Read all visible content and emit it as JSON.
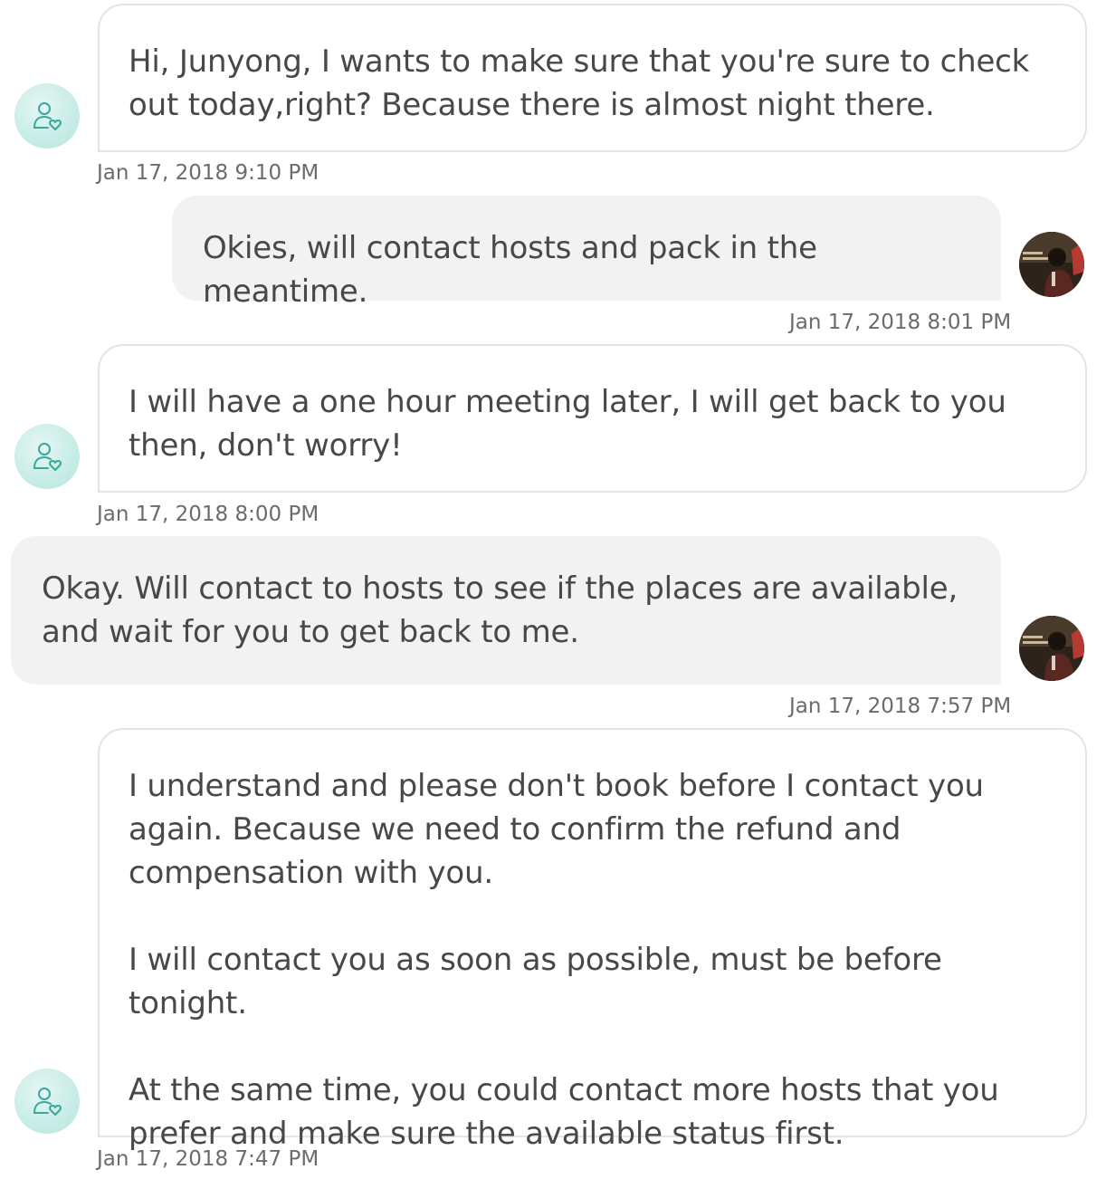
{
  "messages": [
    {
      "sender": "host",
      "text": "Hi, Junyong, I wants to make sure that you're sure to check out today,right? Because there is almost night there.",
      "timestamp": "Jan 17, 2018 9:10 PM",
      "avatar_icon": "host-support-icon"
    },
    {
      "sender": "user",
      "text": "Okies, will contact hosts and pack in the meantime.",
      "timestamp": "Jan 17, 2018 8:01 PM",
      "avatar_icon": "user-photo"
    },
    {
      "sender": "host",
      "text": "I will have a one hour meeting later, I will get back to you then, don't worry!",
      "timestamp": "Jan 17, 2018 8:00 PM",
      "avatar_icon": "host-support-icon"
    },
    {
      "sender": "user",
      "text": "Okay. Will contact to hosts to see if the places are available, and wait for you to get back to me.",
      "timestamp": "Jan 17, 2018 7:57 PM",
      "avatar_icon": "user-photo"
    },
    {
      "sender": "host",
      "text": "I understand and please don't book before I contact you again. Because we need to confirm the refund and compensation with you.\n\nI will contact you as soon as possible, must be before tonight.\n\nAt the same time, you could contact more hosts that you prefer and make sure the available status first.",
      "timestamp": "Jan 17, 2018 7:47 PM",
      "avatar_icon": "host-support-icon"
    }
  ],
  "colors": {
    "host_bubble_bg": "#ffffff",
    "host_bubble_border": "#e4e4e4",
    "user_bubble_bg": "#f2f2f2",
    "host_avatar_bg": "#c7ece6",
    "host_avatar_icon": "#3aa89a",
    "timestamp_text": "#6b6b6b",
    "message_text": "#484848"
  }
}
